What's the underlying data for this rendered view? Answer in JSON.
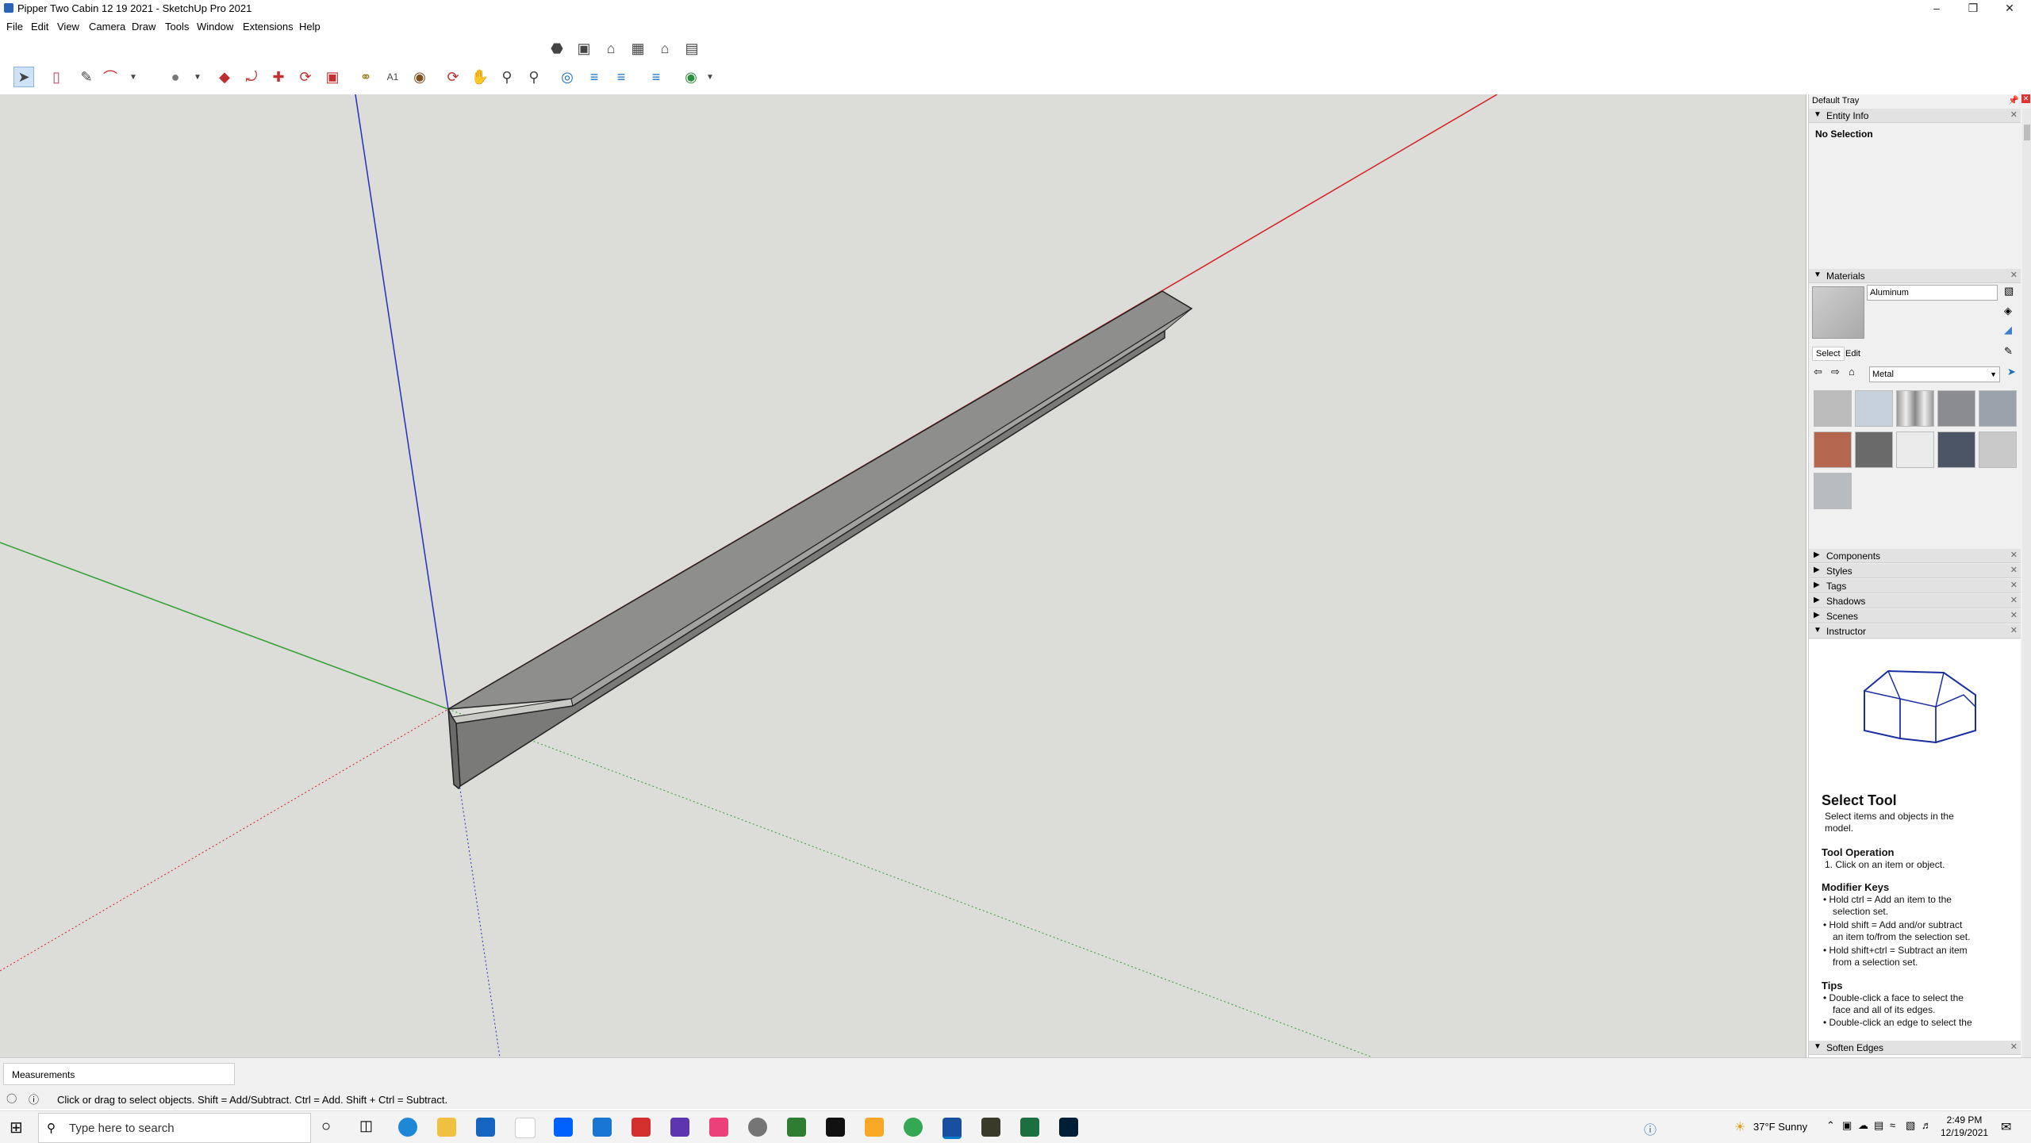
{
  "window": {
    "title": "Pipper Two Cabin 12 19 2021 - SketchUp Pro 2021"
  },
  "menu": [
    "File",
    "Edit",
    "View",
    "Camera",
    "Draw",
    "Tools",
    "Window",
    "Extensions",
    "Help"
  ],
  "toolbar": {
    "views": [
      "iso-view-icon",
      "top-view-icon",
      "front-view-icon",
      "right-view-icon",
      "back-view-icon",
      "left-view-icon"
    ],
    "tools": [
      "select-icon",
      "eraser-icon",
      "pencil-icon",
      "arc-icon",
      "circle-icon",
      "push-pull-icon",
      "follow-me-icon",
      "move-icon",
      "rotate-icon",
      "scale-icon",
      "tape-measure-icon",
      "text-icon",
      "paint-bucket-icon",
      "orbit-icon",
      "pan-icon",
      "zoom-icon",
      "zoom-extents-icon",
      "section-plane-icon",
      "section-cut-icon",
      "tags-icon",
      "outliner-icon",
      "warehouse-icon"
    ]
  },
  "tray": {
    "title": "Default Tray",
    "entity_info": {
      "header": "Entity Info",
      "selection": "No Selection"
    },
    "materials": {
      "header": "Materials",
      "name": "Aluminum",
      "tab_select": "Select",
      "tab_edit": "Edit",
      "library": "Metal"
    },
    "panels": [
      "Components",
      "Styles",
      "Tags",
      "Shadows",
      "Scenes"
    ],
    "instructor": {
      "header": "Instructor",
      "title": "Select Tool",
      "subtitle_line1": "Select items and objects in the",
      "subtitle_line2": "model.",
      "op_header": "Tool Operation",
      "op_step": "1. Click on an item or object.",
      "mod_header": "Modifier Keys",
      "mod1_line1": "Hold ctrl = Add an item to the",
      "mod1_line2": "selection set.",
      "mod2_line1": "Hold shift = Add and/or subtract",
      "mod2_line2": "an item to/from the selection set.",
      "mod3_line1": "Hold shift+ctrl = Subtract an item",
      "mod3_line2": "from a selection set.",
      "tips_header": "Tips",
      "tip1_line1": "Double-click a face to select the",
      "tip1_line2": "face and all of its edges.",
      "tip2_line1": "Double-click an edge to select the"
    },
    "soften": "Soften Edges"
  },
  "status": {
    "measurements_label": "Measurements",
    "hint": "Click or drag to select objects. Shift = Add/Subtract. Ctrl = Add. Shift + Ctrl = Subtract."
  },
  "taskbar": {
    "search_placeholder": "Type here to search",
    "weather": "37°F  Sunny",
    "time": "2:49 PM",
    "date": "12/19/2021"
  },
  "colors": {
    "canvas": "#dcdcd8",
    "red_axis": "#d42020",
    "green_axis": "#30a030",
    "blue_axis": "#2030c0"
  }
}
